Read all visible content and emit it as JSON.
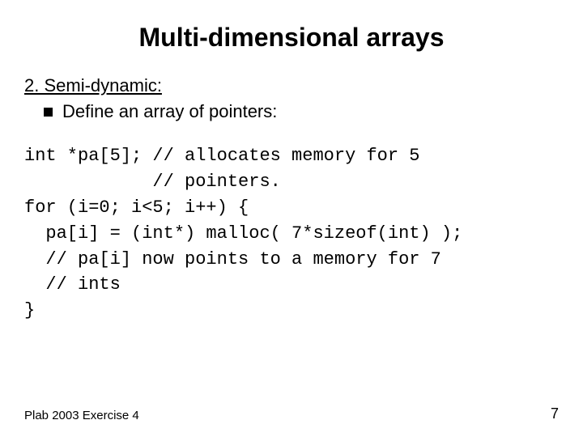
{
  "title": "Multi-dimensional arrays",
  "subheading": "2. Semi-dynamic:",
  "bullet": "Define an array of pointers:",
  "code": "int *pa[5]; // allocates memory for 5\n            // pointers.\nfor (i=0; i<5; i++) {\n  pa[i] = (int*) malloc( 7*sizeof(int) );\n  // pa[i] now points to a memory for 7\n  // ints\n}",
  "footer_left": "Plab 2003 Exercise 4",
  "page_number": "7"
}
